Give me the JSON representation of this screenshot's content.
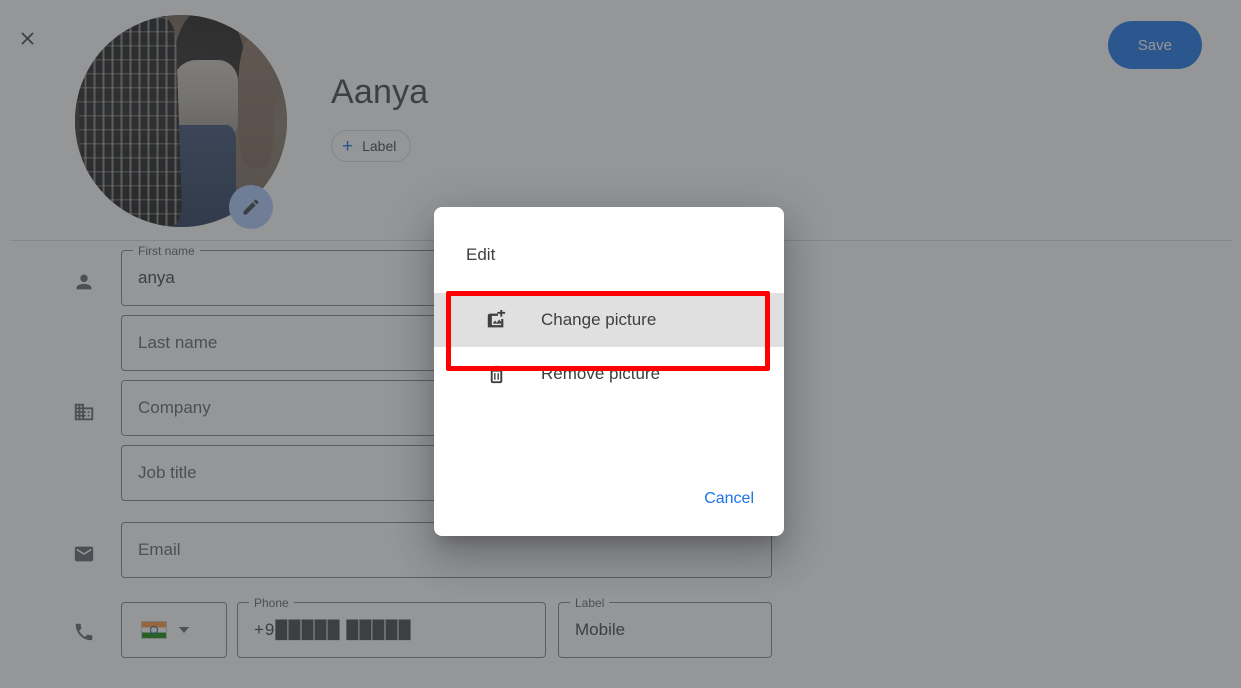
{
  "app": {
    "close_icon": "close-icon",
    "save_label": "Save",
    "accent_blue": "#1a73e8",
    "scrim_color": "rgba(60,64,67,0.55)",
    "highlight_color": "#ff0000"
  },
  "profile": {
    "name": "Aanya",
    "label_chip": "Label",
    "label_chip_plus": "+",
    "avatar_edit_icon": "pencil-icon",
    "avatar_alt": "contact-photo"
  },
  "form": {
    "rows": [
      {
        "icon": "person-icon",
        "fields": [
          {
            "legend": "First name",
            "value": "anya",
            "placeholder": ""
          },
          {
            "legend": "",
            "value": "",
            "placeholder": "Last name"
          }
        ]
      },
      {
        "icon": "building-icon",
        "fields": [
          {
            "legend": "",
            "value": "",
            "placeholder": "Company"
          },
          {
            "legend": "",
            "value": "",
            "placeholder": "Job title"
          }
        ]
      },
      {
        "icon": "email-icon",
        "fields": [
          {
            "legend": "",
            "value": "",
            "placeholder": "Email"
          }
        ]
      }
    ],
    "phone_row": {
      "icon": "phone-icon",
      "country_flag": "india-flag-icon",
      "country_caret": "chevron-down-icon",
      "phone_legend": "Phone",
      "phone_value": "+9█████ █████",
      "label_legend": "Label",
      "label_value": "Mobile"
    }
  },
  "dialog": {
    "title": "Edit",
    "items": [
      {
        "icon": "add-photo-icon",
        "label": "Change picture",
        "highlighted": true
      },
      {
        "icon": "trash-icon",
        "label": "Remove picture",
        "highlighted": false
      }
    ],
    "cancel_label": "Cancel"
  }
}
